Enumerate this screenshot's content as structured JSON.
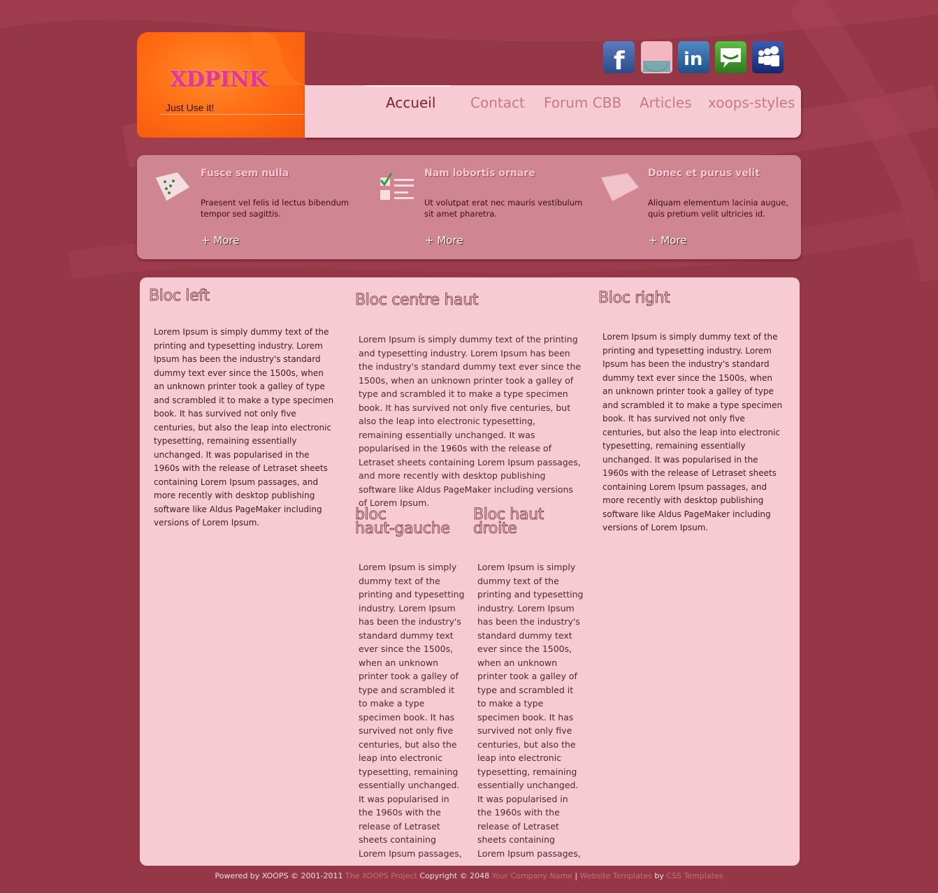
{
  "site": {
    "logo": "XDPINK",
    "slogan": "Just Use it!"
  },
  "social": [
    {
      "name": "facebook",
      "color": "#3b5b99"
    },
    {
      "name": "stumbleupon",
      "color": "#eeeeee"
    },
    {
      "name": "linkedin",
      "color": "#2a6aa0"
    },
    {
      "name": "chat",
      "color": "#3f9b2c"
    },
    {
      "name": "myspace",
      "color": "#1f3a88"
    }
  ],
  "nav": [
    {
      "label": "Accueil",
      "active": true
    },
    {
      "label": "Contact",
      "active": false
    },
    {
      "label": "Forum CBB",
      "active": false
    },
    {
      "label": "Articles",
      "active": false
    },
    {
      "label": "xoops-styles",
      "active": false
    }
  ],
  "features": [
    {
      "title": "Fusce sem nulla",
      "text": "Praesent vel felis id lectus bibendum tempor sed sagittis.",
      "more": "+ More",
      "icon": "map-icon"
    },
    {
      "title": "Nam lobortis ornare",
      "text": "Ut volutpat erat nec mauris vestibulum sit amet pharetra.",
      "more": "+ More",
      "icon": "checklist-icon"
    },
    {
      "title": "Donec et purus velit",
      "text": "Aliquam elementum lacinia augue, quis pretium velit ultricies id.",
      "more": "+ More",
      "icon": "note-icon"
    }
  ],
  "blocs": {
    "left": {
      "title": "Bloc left",
      "text": "Lorem Ipsum is simply dummy text of the printing and typesetting industry. Lorem Ipsum has been the industry's standard dummy text ever since the 1500s, when an unknown printer took a galley of type and scrambled it to make a type specimen book. It has survived not only five centuries, but also the leap into electronic typesetting, remaining essentially unchanged. It was popularised in the 1960s with the release of Letraset sheets containing Lorem Ipsum passages, and more recently with desktop publishing software like Aldus PageMaker including versions of Lorem Ipsum."
    },
    "centre_haut": {
      "title": "Bloc centre haut",
      "text": "Lorem Ipsum is simply dummy text of the printing and typesetting industry. Lorem Ipsum has been the industry's standard dummy text ever since the 1500s, when an unknown printer took a galley of type and scrambled it to make a type specimen book. It has survived not only five centuries, but also the leap into electronic typesetting, remaining essentially unchanged. It was popularised in the 1960s with the release of Letraset sheets containing Lorem Ipsum passages, and more recently with desktop publishing software like Aldus PageMaker including versions of Lorem Ipsum."
    },
    "haut_gauche": {
      "title_line1": "bloc",
      "title_line2": "haut-gauche",
      "text": "Lorem Ipsum is simply dummy text of the printing and typesetting industry. Lorem Ipsum has been the industry's standard dummy text ever since the 1500s, when an unknown printer took a galley of type and scrambled it to make a type specimen book. It has survived not only five centuries, but also the leap into electronic typesetting, remaining essentially unchanged. It was popularised in the 1960s with the release of Letraset sheets containing Lorem Ipsum passages,"
    },
    "haut_droite": {
      "title_line1": "Bloc haut",
      "title_line2": "droite",
      "text": "Lorem Ipsum is simply dummy text of the printing and typesetting industry. Lorem Ipsum has been the industry's standard dummy text ever since the 1500s, when an unknown printer took a galley of type and scrambled it to make a type specimen book. It has survived not only five centuries, but also the leap into electronic typesetting, remaining essentially unchanged. It was popularised in the 1960s with the release of Letraset sheets containing Lorem Ipsum passages,"
    },
    "right": {
      "title": "Bloc right",
      "text": "Lorem Ipsum is simply dummy text of the printing and typesetting industry. Lorem Ipsum has been the industry's standard dummy text ever since the 1500s, when an unknown printer took a galley of type and scrambled it to make a type specimen book. It has survived not only five centuries, but also the leap into electronic typesetting, remaining essentially unchanged. It was popularised in the 1960s with the release of Letraset sheets containing Lorem Ipsum passages, and more recently with desktop publishing software like Aldus PageMaker including versions of Lorem Ipsum."
    }
  },
  "footer": {
    "powered": "Powered by XOOPS © 2001-2011",
    "xoops_link": "The XOOPS Project",
    "copyright": "Copyright © 2048",
    "company_link": "Your Company Name",
    "separator": "|",
    "templates_link": "Website Templates",
    "by": "by",
    "css_link": "CSS Templates"
  }
}
